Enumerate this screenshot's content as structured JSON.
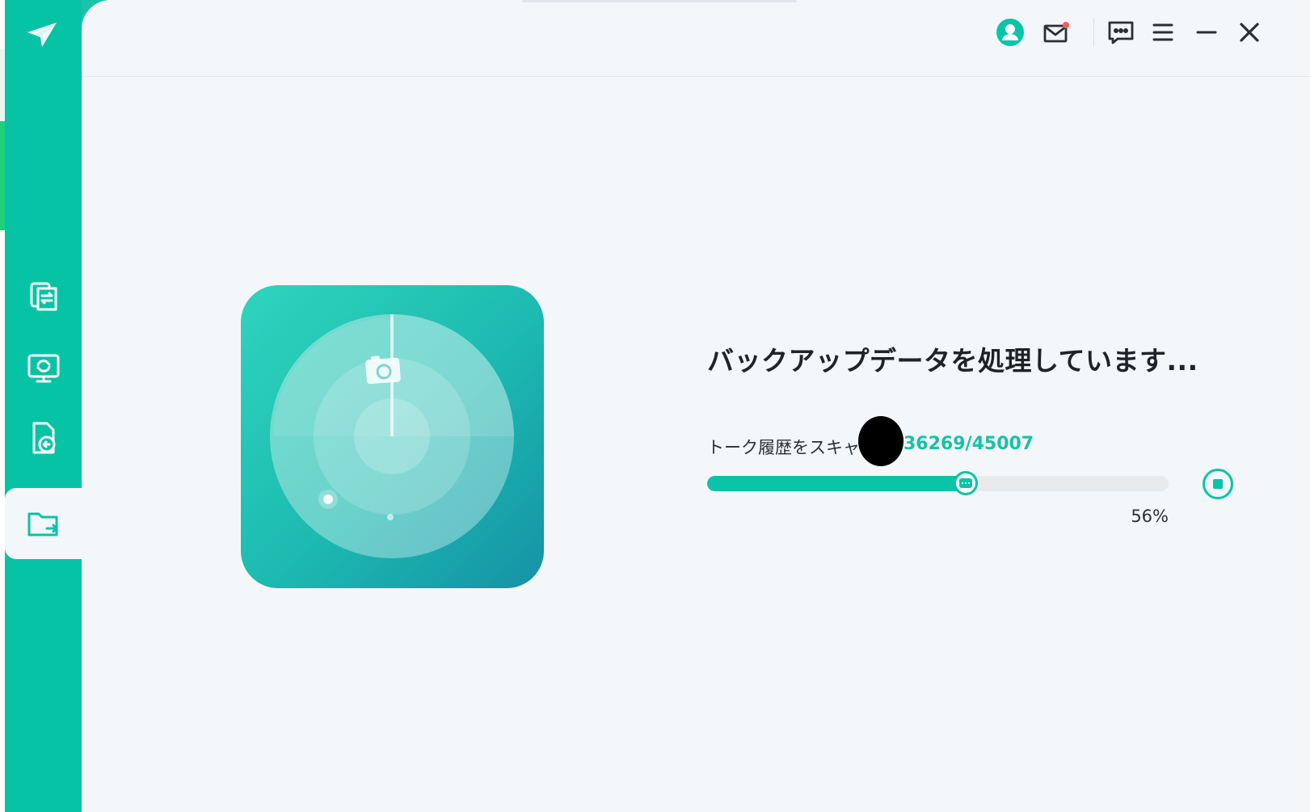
{
  "colors": {
    "accent": "#09c4a7",
    "sidebar": "#07c3a6",
    "background": "#f4f7fa",
    "notification_dot": "#ff5a5a"
  },
  "sidebar": {
    "logo_icon": "paper-plane-logo-icon",
    "items": [
      {
        "name": "transfer",
        "icon": "document-transfer-icon",
        "active": false
      },
      {
        "name": "pc-backup",
        "icon": "monitor-sync-icon",
        "active": false
      },
      {
        "name": "restore",
        "icon": "document-restore-icon",
        "active": false
      },
      {
        "name": "export",
        "icon": "folder-export-icon",
        "active": true
      }
    ]
  },
  "topbar": {
    "icons": [
      "user-avatar-icon",
      "mail-icon",
      "feedback-chat-icon",
      "menu-icon",
      "minimize-icon",
      "close-icon"
    ],
    "mail_has_notification": true
  },
  "main": {
    "illustration_icon": "scan-radar-icon",
    "title": "バックアップデータを処理しています...",
    "scan_label": "トーク履歴をスキャン",
    "scan_count": "36269/45007",
    "progress": 0.56,
    "percent_text": "56%",
    "stop_icon": "stop-icon"
  }
}
